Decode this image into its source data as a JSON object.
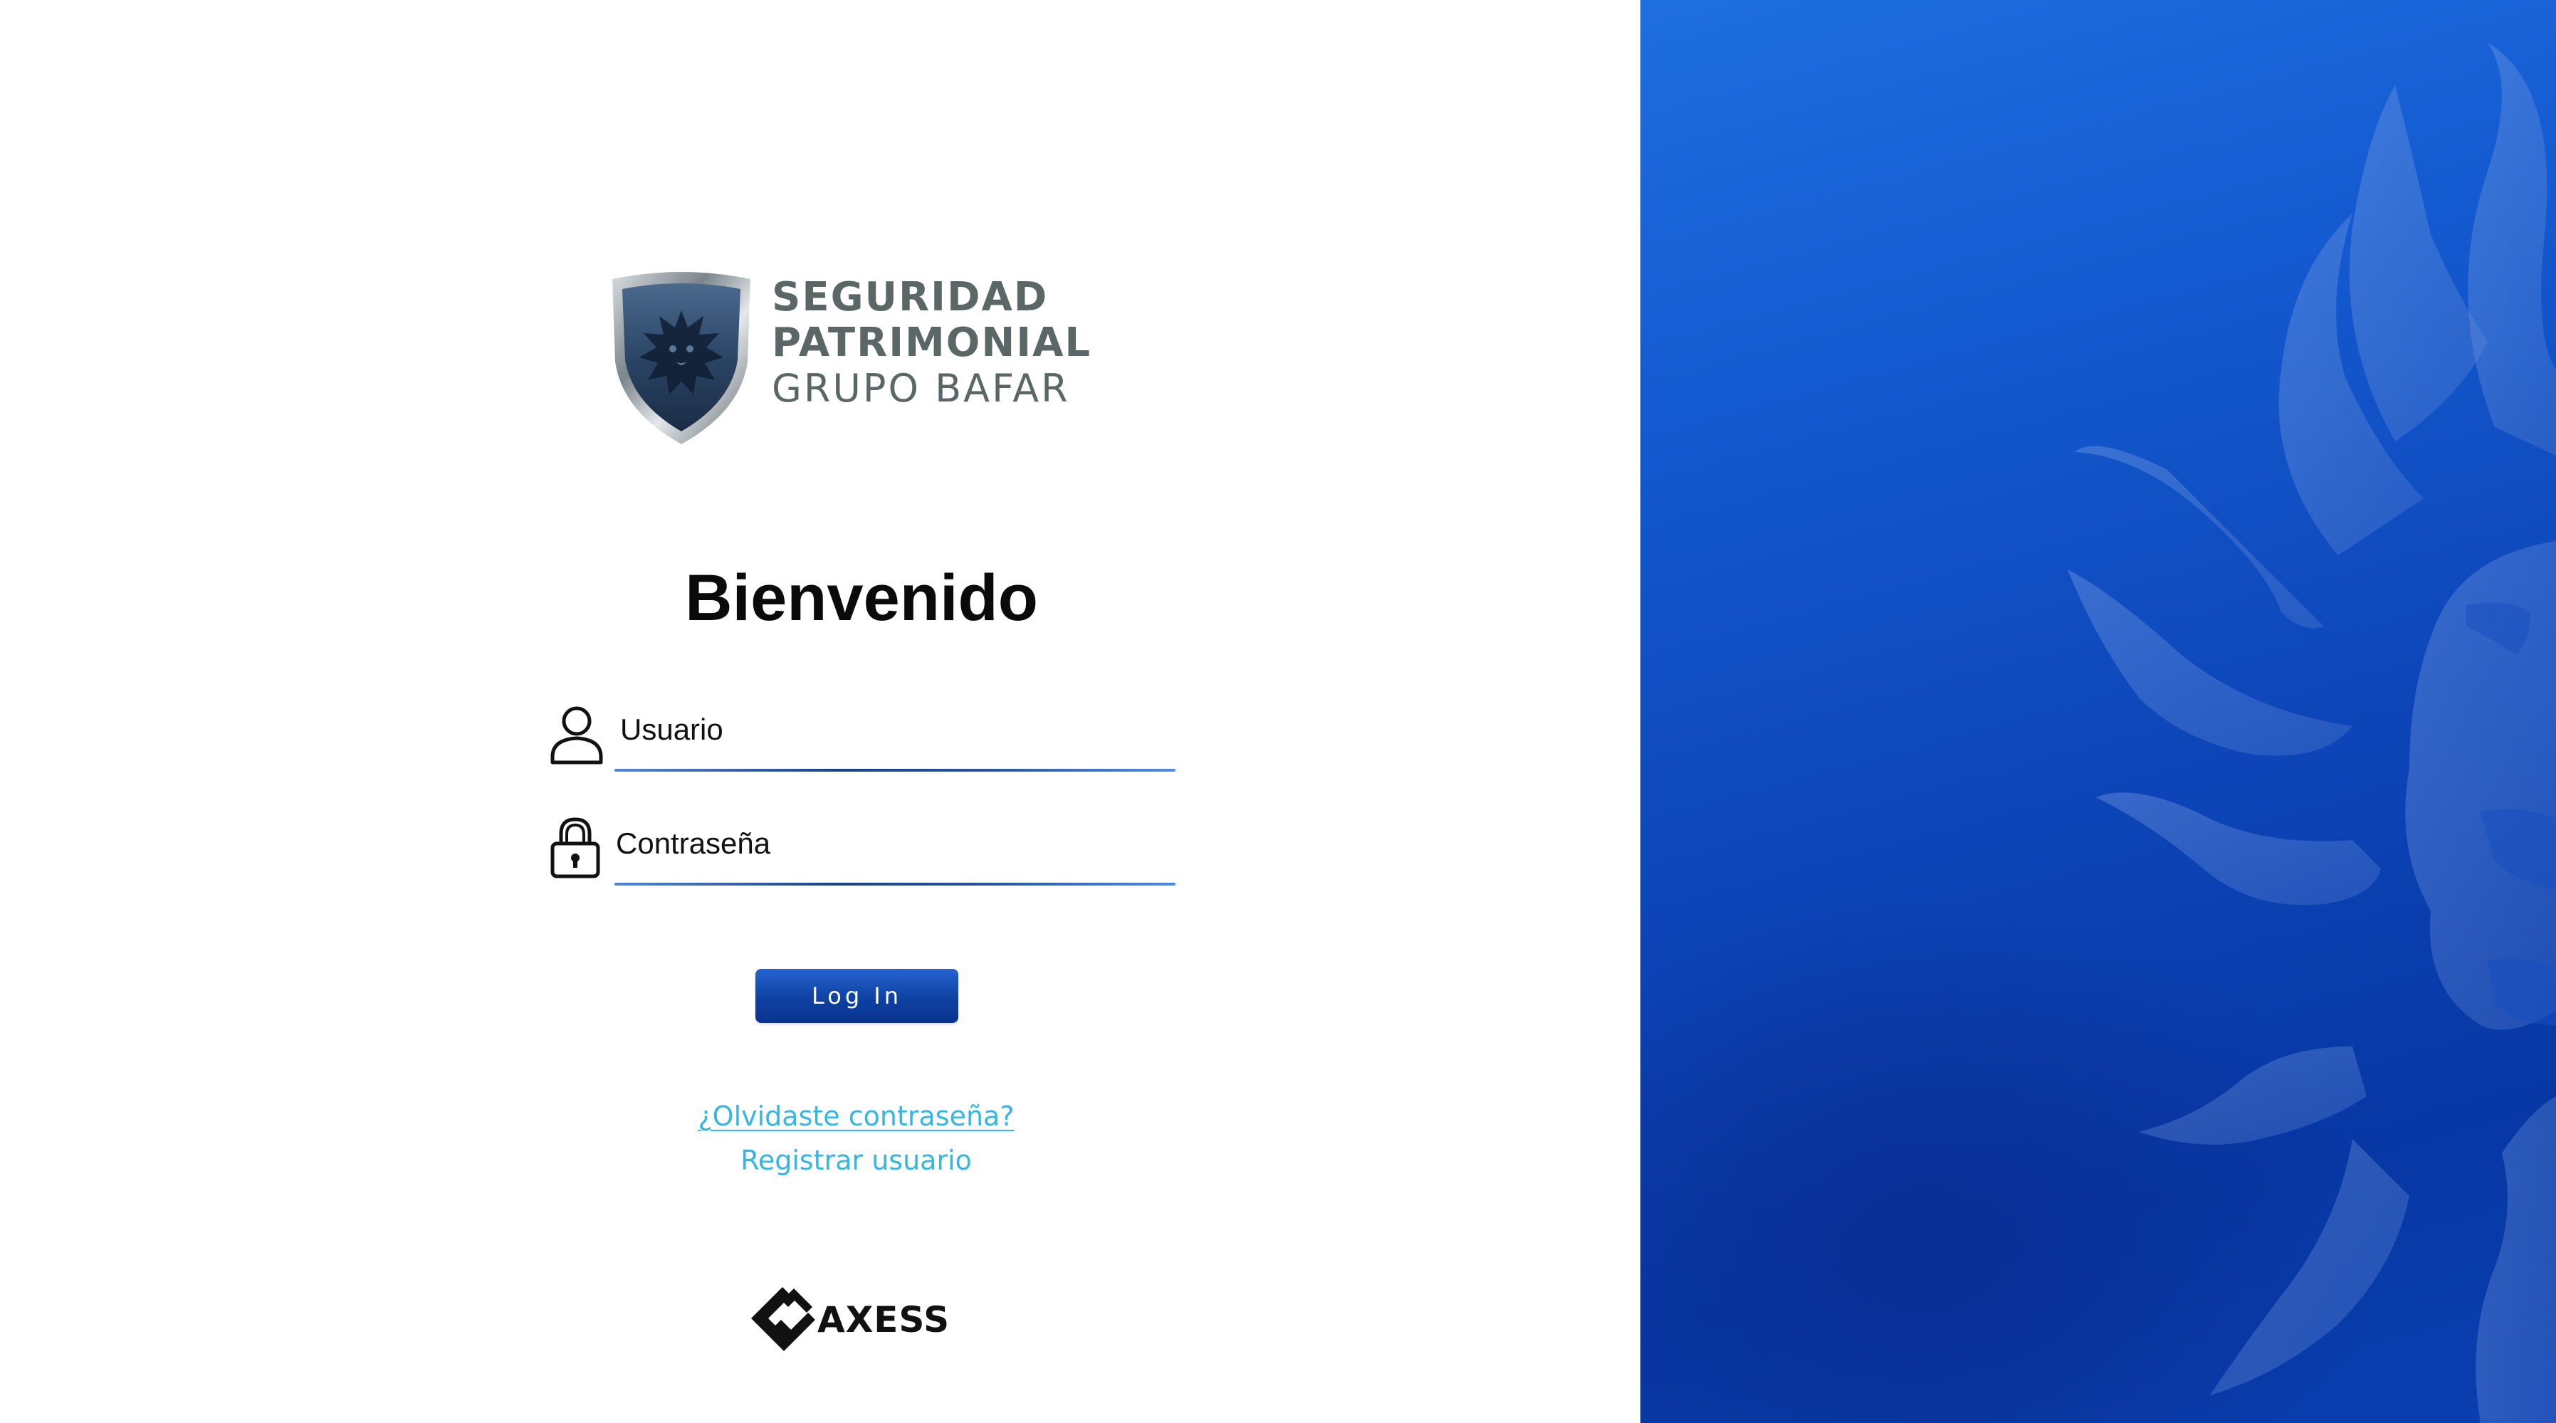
{
  "brand": {
    "line1": "SEGURIDAD",
    "line2": "PATRIMONIAL",
    "line3": "GRUPO BAFAR",
    "text_color": "#5b6767"
  },
  "login": {
    "title": "Bienvenido",
    "username_placeholder": "Usuario",
    "password_placeholder": "Contraseña",
    "login_button": "Log In",
    "forgot_password": "¿Olvidaste contraseña?",
    "register": "Registrar usuario"
  },
  "footer": {
    "logo_text": "AXESS"
  },
  "colors": {
    "accent": "#0d3f9f",
    "link": "#37b5e3",
    "panel_blue": "#145ad0"
  }
}
